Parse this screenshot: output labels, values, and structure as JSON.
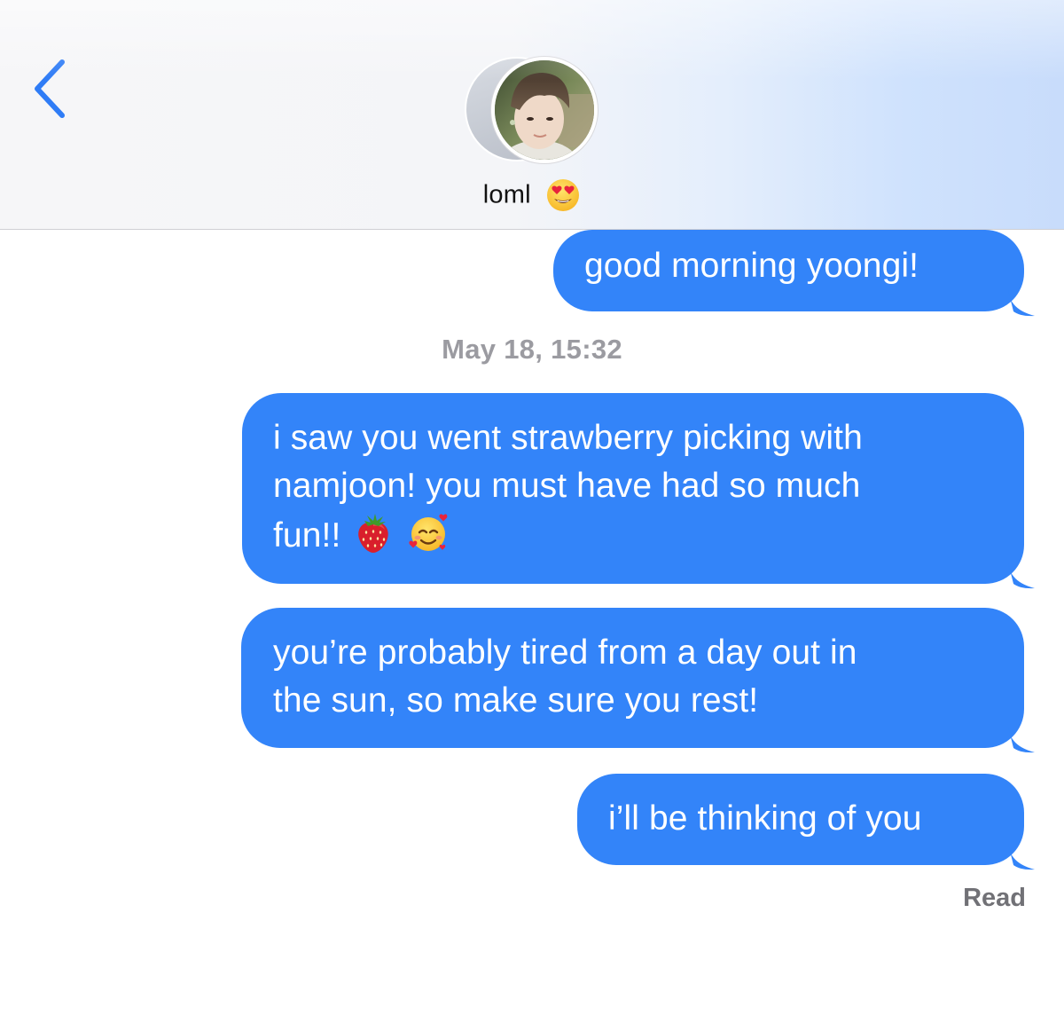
{
  "header": {
    "contact_name": "loml",
    "contact_emoji": "heart-eyes-emoji",
    "back_icon": "chevron-left-icon"
  },
  "messages": [
    {
      "direction": "sent",
      "lines": [
        "good morning yoongi!"
      ]
    },
    {
      "direction": "sent",
      "lines": [
        "i saw you went strawberry picking with",
        "namjoon! you must have had so much",
        "fun!!"
      ],
      "emojis": [
        "strawberry-emoji",
        "smiling-face-with-hearts-emoji"
      ]
    },
    {
      "direction": "sent",
      "lines": [
        "you’re probably tired from a day out in",
        "the sun, so make sure you rest!"
      ]
    },
    {
      "direction": "sent",
      "lines": [
        "i’ll be thinking of you"
      ]
    }
  ],
  "timestamp": "May 18, 15:32",
  "read_receipt": "Read",
  "colors": {
    "bubble": "#3384f9",
    "accent": "#2f7cf6",
    "timestamp": "#9b9ba1"
  }
}
